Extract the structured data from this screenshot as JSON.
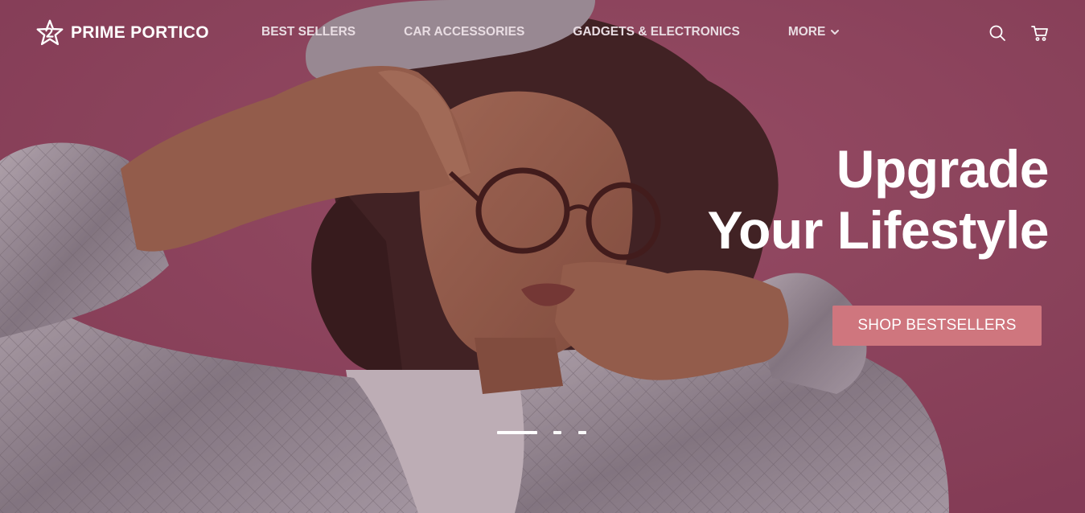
{
  "brand": {
    "name": "PRIME PORTICO",
    "logo_icon": "star-badge-icon"
  },
  "nav": {
    "items": [
      {
        "label": "BEST SELLERS"
      },
      {
        "label": "CAR ACCESSORIES"
      },
      {
        "label": "GADGETS & ELECTRONICS"
      },
      {
        "label": "MORE",
        "icon": "chevron-down-icon"
      }
    ]
  },
  "header_icons": [
    "search-icon",
    "cart-icon"
  ],
  "hero": {
    "headline_line1": "Upgrade",
    "headline_line2": "Your Lifestyle",
    "cta_label": "SHOP BESTSELLERS",
    "image": "woman-with-glasses-photo"
  },
  "slider": {
    "slide_count": 3,
    "active_slide": 1
  },
  "colors": {
    "background": "#9e4e68",
    "cta": "#cf767e",
    "text": "#ffffff"
  }
}
